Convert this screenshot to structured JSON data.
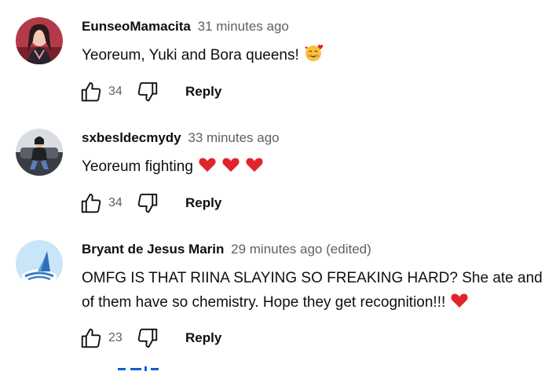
{
  "comments": [
    {
      "author": "EunseoMamacita",
      "time": "31 minutes ago",
      "edited": "",
      "text_lines": [
        "Yeoreum, Yuki and Bora queens!"
      ],
      "emoji": "smiling-face-with-hearts",
      "likes": "34",
      "reply_label": "Reply"
    },
    {
      "author": "sxbesldecmydy",
      "time": "33 minutes ago",
      "edited": "",
      "text_lines": [
        "Yeoreum fighting"
      ],
      "emoji": "red-heart x3",
      "likes": "34",
      "reply_label": "Reply"
    },
    {
      "author": "Bryant de Jesus Marin",
      "time": "29 minutes ago",
      "edited": "(edited)",
      "text_lines": [
        "OMFG IS THAT RIINA SLAYING SO FREAKING HARD? She ate and",
        "of them have so chemistry. Hope they get recognition!!!"
      ],
      "emoji": "red-heart",
      "likes": "23",
      "reply_label": "Reply"
    }
  ],
  "icons": {
    "like": "thumbs-up-outline-icon",
    "dislike": "thumbs-down-outline-icon"
  },
  "colors": {
    "text": "#0f0f0f",
    "secondary": "#606060",
    "heart": "#e0242c",
    "link": "#065fd4"
  }
}
